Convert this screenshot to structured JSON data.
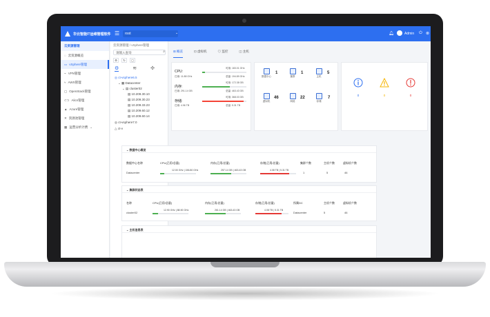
{
  "topbar": {
    "app_title": "华云智能IT运维管理软件",
    "user_select": "root",
    "username": "Admin"
  },
  "sidebar": {
    "home": "云资源管理",
    "items": [
      {
        "label": "云资源概览"
      },
      {
        "label": "vSphere管理"
      },
      {
        "label": "VPN管理"
      },
      {
        "label": "AWS管理"
      },
      {
        "label": "OpenStack管理"
      },
      {
        "label": "Alicn管理"
      },
      {
        "label": "Azure管理"
      },
      {
        "label": "资源池管理"
      },
      {
        "label": "运营分析计费"
      }
    ]
  },
  "tree": {
    "breadcrumb": "云资源管理 / vSphere管理",
    "search_placeholder": "请输入查询",
    "nodes": [
      {
        "label": "ct-vsphere6.5"
      },
      {
        "label": "Datacenter"
      },
      {
        "label": "cluster02"
      },
      {
        "label": "10.209.30.10"
      },
      {
        "label": "10.209.30.23"
      },
      {
        "label": "10.209.33.23"
      },
      {
        "label": "10.209.60.12"
      },
      {
        "label": "10.209.60.14"
      },
      {
        "label": "ct-vsphere7.0"
      },
      {
        "label": "ct-v"
      }
    ]
  },
  "main": {
    "tabs": [
      {
        "label": "概览"
      },
      {
        "label": "虚拟机"
      },
      {
        "label": "监控"
      },
      {
        "label": "主机"
      }
    ],
    "resources": [
      {
        "label": "CPU:",
        "top_value": "可用: 183.01 GHz",
        "used": "已用: 11.88 GHz",
        "total": "总量: 194.89 GHz",
        "pct": 0.06,
        "color": "#4caf50"
      },
      {
        "label": "内存:",
        "top_value": "可用: 172.38 GB",
        "used": "已用: 291.14 GB",
        "total": "总量: 463.43 GB",
        "pct": 0.63,
        "color": "#4caf50"
      },
      {
        "label": "存储:",
        "top_value": "可用: 368.03 GB",
        "used": "已用: 4.96 TB",
        "total": "总量: 5.31 TB",
        "pct": 0.93,
        "color": "#f44336"
      }
    ],
    "inventory": [
      {
        "label": "数据中心",
        "count": "1"
      },
      {
        "label": "集群",
        "count": "1"
      },
      {
        "label": "主机",
        "count": "5"
      },
      {
        "label": "虚拟机",
        "count": "46"
      },
      {
        "label": "网络",
        "count": "22"
      },
      {
        "label": "存储",
        "count": "7"
      }
    ],
    "alarms": [
      {
        "count": "0",
        "color": "#2d6ff0",
        "icon": "info-icon"
      },
      {
        "count": "0",
        "color": "#f5b400",
        "icon": "warning-icon"
      },
      {
        "count": "0",
        "color": "#e53935",
        "icon": "error-icon"
      }
    ]
  },
  "datacenter_section": {
    "title": "数据中心概览",
    "headers": [
      "数据中心名称",
      "CPU(已用/总量)",
      "内存(已用/总量)",
      "存储(已用/总量)",
      "集群个数",
      "主机个数",
      "虚拟机个数"
    ],
    "row": {
      "name": "Datacenter",
      "cpu": "12.00 GHz | 156.80 GHz",
      "mem": "257.14 GB | 463.43 GB",
      "storage": "4.08 TB | 5.31 TB",
      "clusters": "1",
      "hosts": "5",
      "vms": "46"
    }
  },
  "cluster_section": {
    "title": "集群状态表",
    "headers": [
      "名称",
      "CPU(已用/总量)",
      "内存(已用/总量)",
      "存储(已用/总量)",
      "所属DC",
      "主机个数",
      "虚拟机个数"
    ],
    "row": {
      "name": "cluster02",
      "cpu": "12.90 GHz | 88.90 GHz",
      "mem": "261.14 GB | 463.43 GB",
      "storage": "4.08 TB | 5.31 TB",
      "dc": "Datacenter",
      "hosts": "5",
      "vms": "46"
    }
  },
  "host_section": {
    "title": "主机信息表"
  }
}
